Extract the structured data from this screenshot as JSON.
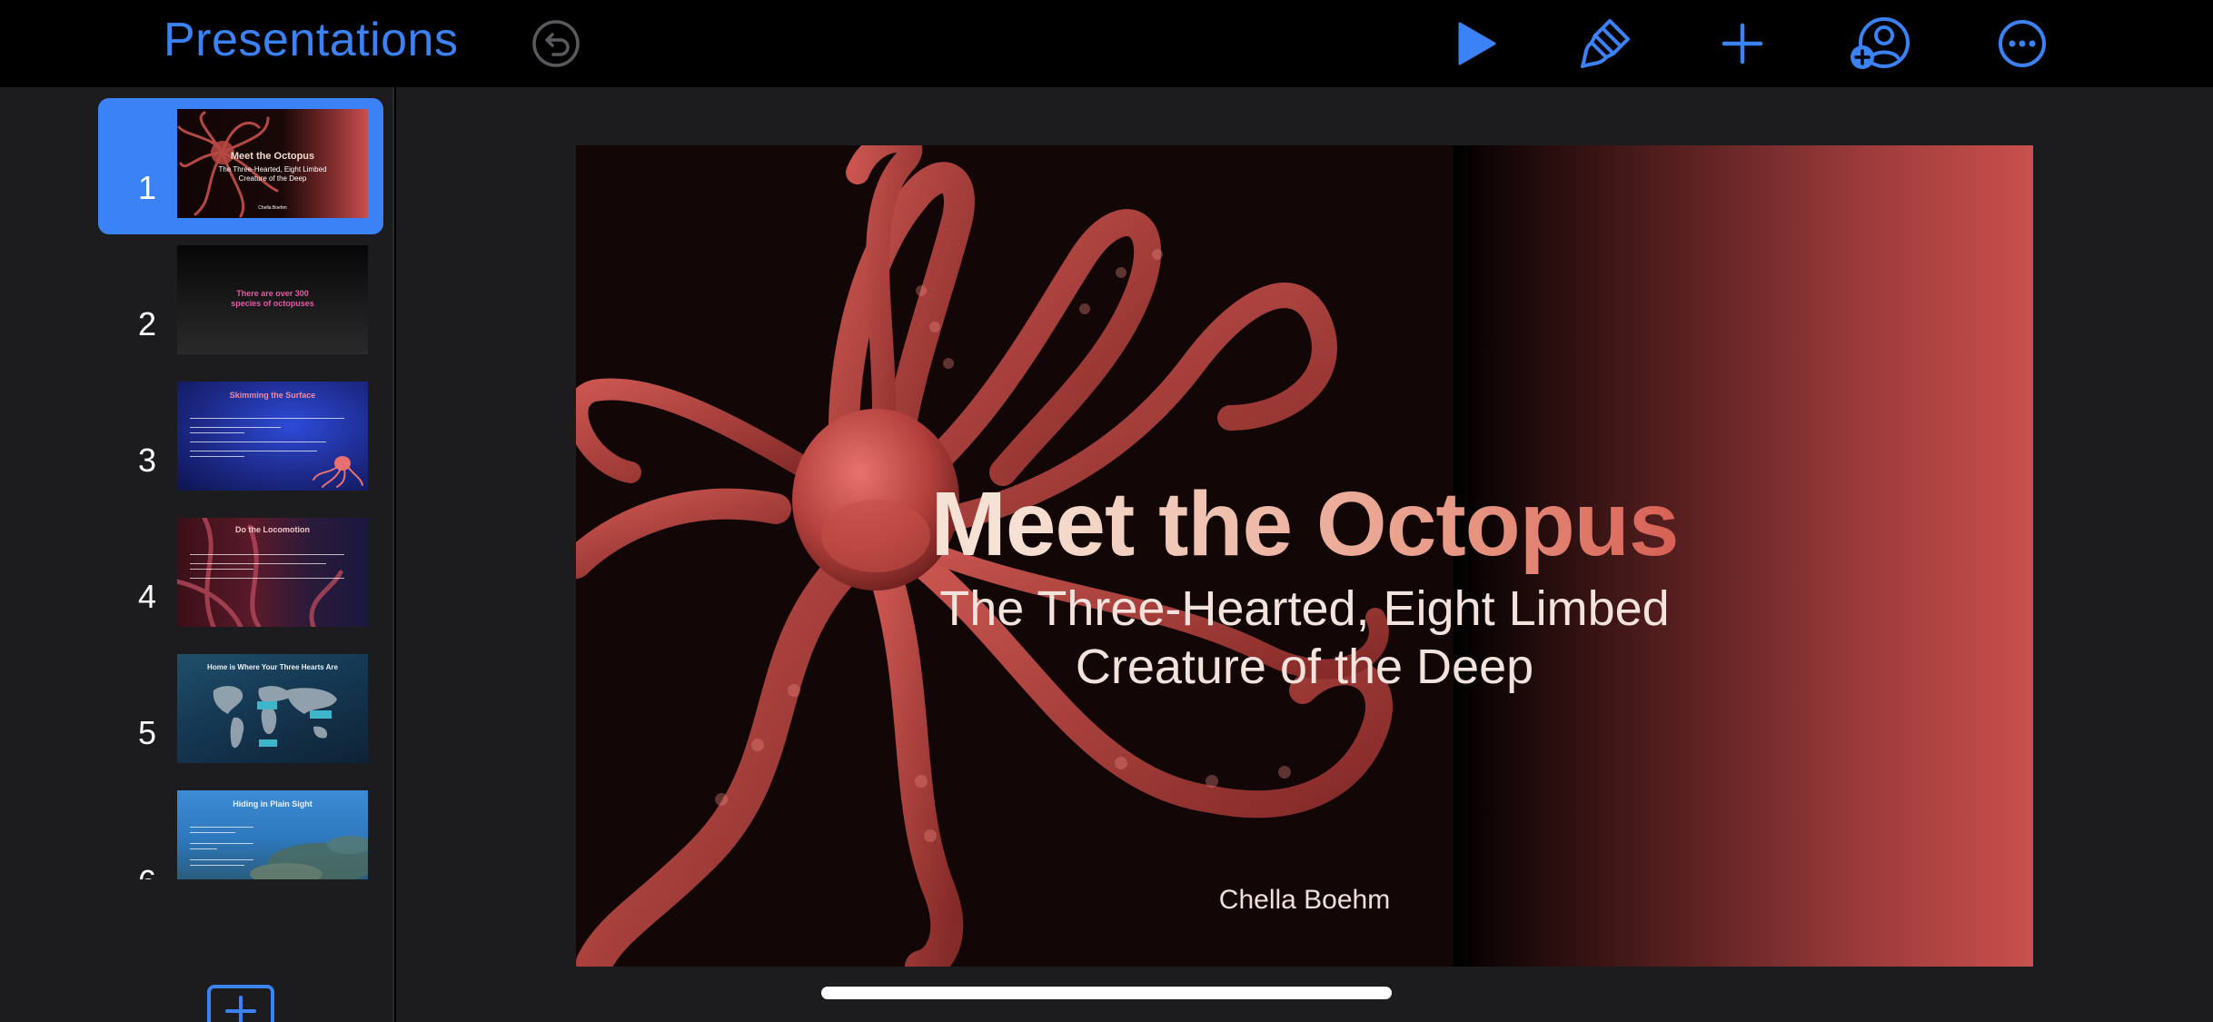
{
  "toolbar": {
    "back_label": "Presentations",
    "undo_icon": "undo-icon",
    "play_icon": "play-icon",
    "format_icon": "paintbrush-icon",
    "add_icon": "plus-icon",
    "collaborate_icon": "add-person-icon",
    "more_icon": "ellipsis-circle-icon",
    "accent_color": "#3a82f6"
  },
  "navigator": {
    "slides": [
      {
        "number": "1",
        "title": "Meet the Octopus",
        "subtitle": "The Three-Hearted, Eight Limbed Creature of the Deep",
        "author": "Chella Boehm",
        "selected": true
      },
      {
        "number": "2",
        "title": "There are over 300 species of octopuses",
        "selected": false
      },
      {
        "number": "3",
        "title": "Skimming the Surface",
        "selected": false
      },
      {
        "number": "4",
        "title": "Do the Locomotion",
        "selected": false
      },
      {
        "number": "5",
        "title": "Home is Where Your Three Hearts Are",
        "selected": false
      },
      {
        "number": "6",
        "title": "Hiding in Plain Sight",
        "selected": false
      }
    ],
    "add_slide_icon": "plus-square-icon"
  },
  "slide": {
    "title": "Meet the Octopus",
    "subtitle_line1": "The Three-Hearted, Eight Limbed",
    "subtitle_line2": "Creature of the Deep",
    "author": "Chella Boehm",
    "accent_red": "#c9504d"
  }
}
